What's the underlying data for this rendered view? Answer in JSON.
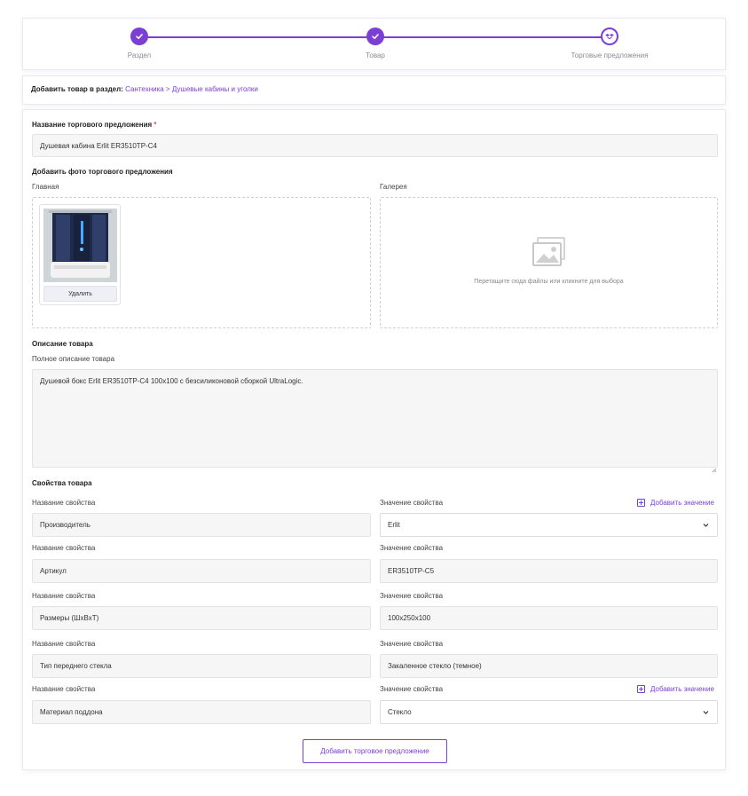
{
  "stepper": {
    "steps": [
      {
        "label": "Раздел",
        "state": "done",
        "icon": "check-icon"
      },
      {
        "label": "Товар",
        "state": "done",
        "icon": "check-icon"
      },
      {
        "label": "Торговые предложения",
        "state": "current",
        "icon": "dropbox-icon"
      }
    ]
  },
  "breadcrumb": {
    "prefix": "Добавить товар в раздел:",
    "path": "Сантехника > Душевые кабины и уголки"
  },
  "form": {
    "offer_name_label": "Название торгового предложения",
    "required_mark": "*",
    "offer_name_value": "Душевая кабина Erlit ER3510TP-C4",
    "photos_label": "Добавить фото торгового предложения",
    "main_label": "Главная",
    "gallery_label": "Галерея",
    "delete_label": "Удалить",
    "dropzone_text": "Перетащите сюда файлы или кликните для выбора",
    "description_section": "Описание товара",
    "full_description_label": "Полное описание товара",
    "full_description_value": "Душевой бокс Erlit ER3510TP-C4 100x100 с безсиликоновой сборкой UltraLogic.",
    "properties_section": "Свойства товара",
    "prop_name_label": "Название свойства",
    "prop_value_label": "Значение свойства",
    "add_value_label": "Добавить значение",
    "properties": [
      {
        "name": "Производитель",
        "value": "Erlit",
        "type": "select"
      },
      {
        "name": "Артикул",
        "value": "ER3510TP-C5",
        "type": "text"
      },
      {
        "name": "Размеры (ШхВхТ)",
        "value": "100x250x100",
        "type": "text"
      },
      {
        "name": "Тип переднего стекла",
        "value": "Закаленное стекло (темное)",
        "type": "text"
      },
      {
        "name": "Материал поддона",
        "value": "Стекло",
        "type": "select"
      }
    ],
    "submit_label": "Добавить торговое предложение"
  },
  "colors": {
    "accent": "#7b3fd6",
    "field_bg": "#f6f6f6",
    "border": "#e3e3e3"
  }
}
